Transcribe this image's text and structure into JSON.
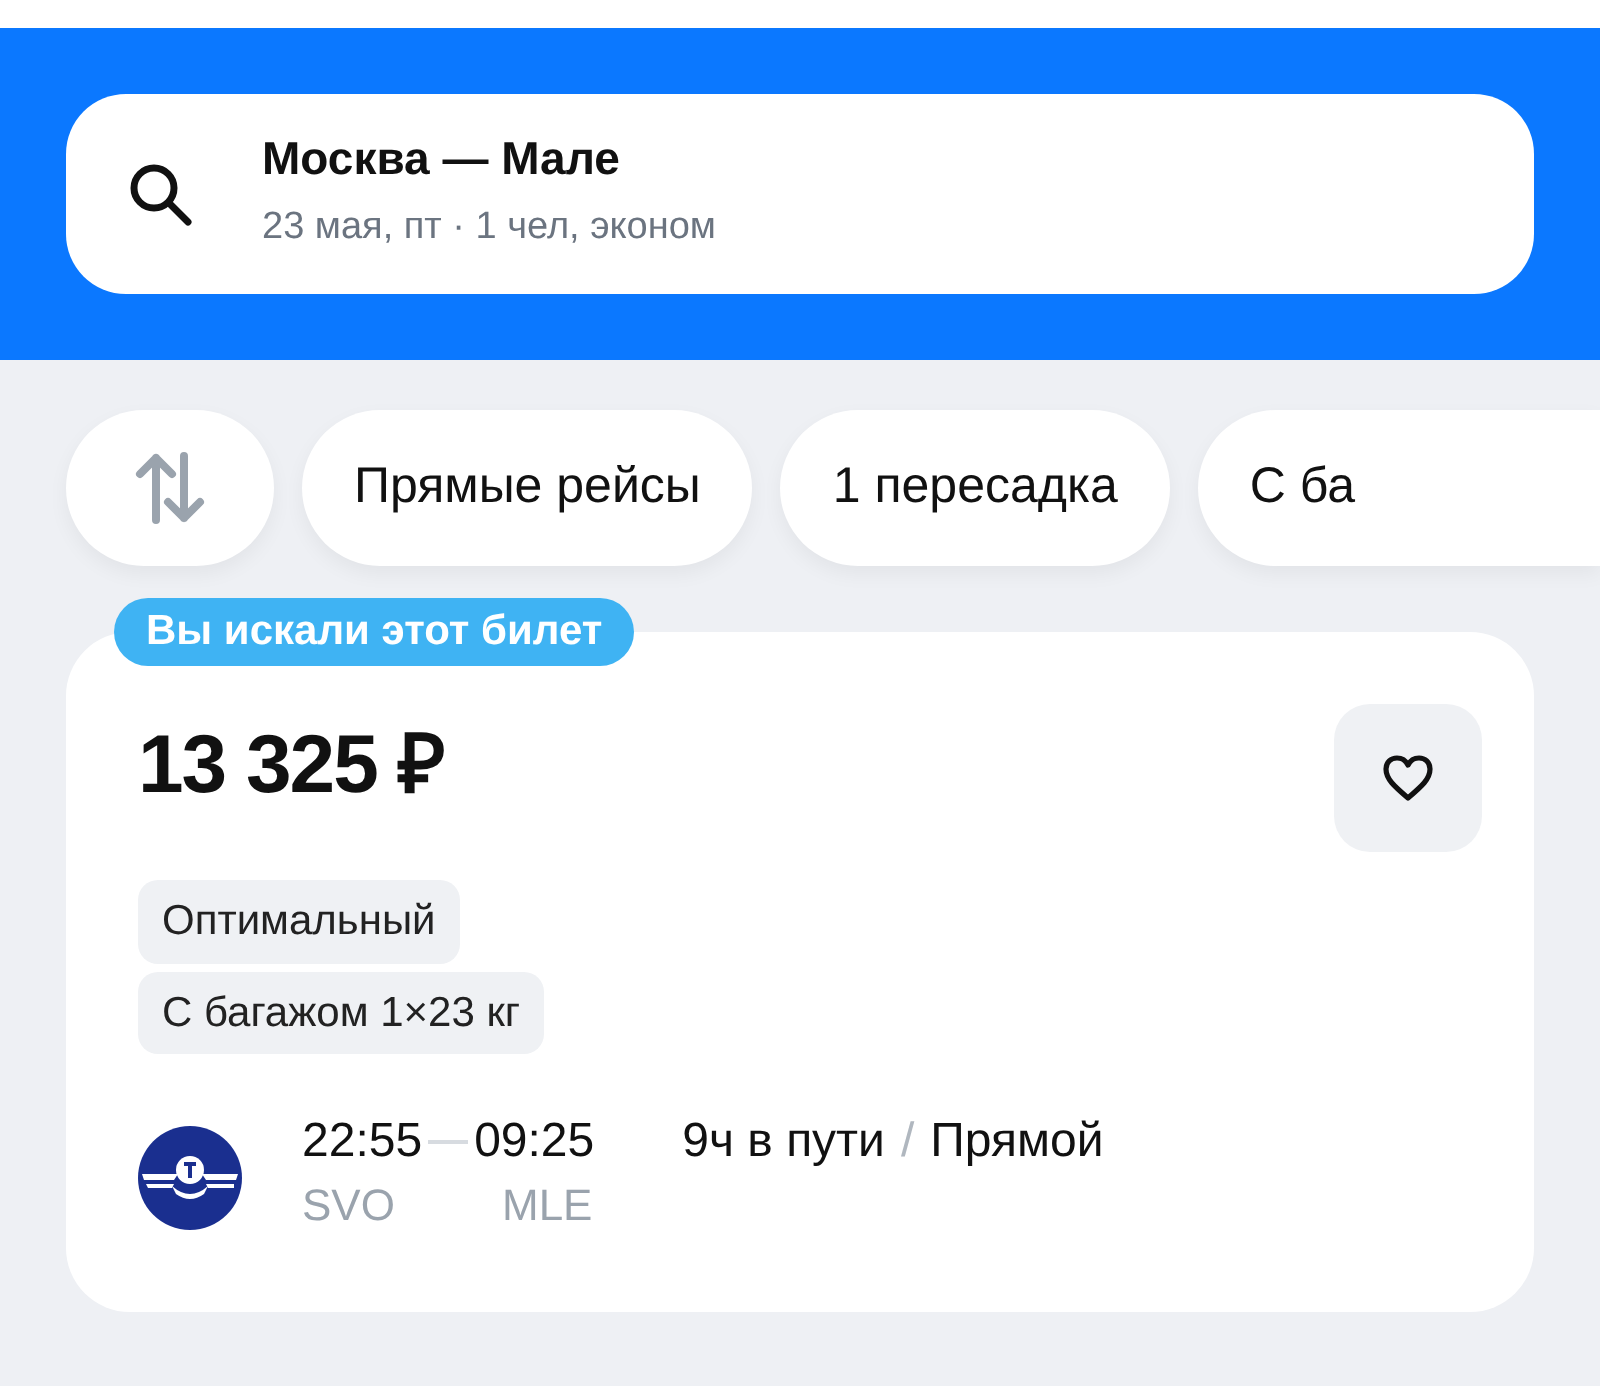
{
  "search": {
    "route": "Москва — Мале",
    "details": "23 мая, пт · 1 чел, эконом"
  },
  "filters": [
    {
      "label": "Прямые рейсы"
    },
    {
      "label": "1 пересадка"
    },
    {
      "label": "С ба"
    }
  ],
  "ticket": {
    "badge": "Вы искали этот билет",
    "price": "13 325 ₽",
    "favorite": false,
    "tags": [
      "Оптимальный",
      "С багажом 1×23 кг"
    ],
    "departure_time": "22:55",
    "arrival_time": "09:25",
    "departure_airport": "SVO",
    "arrival_airport": "MLE",
    "duration": "9ч в пути",
    "separator": "/",
    "flight_type": "Прямой"
  }
}
